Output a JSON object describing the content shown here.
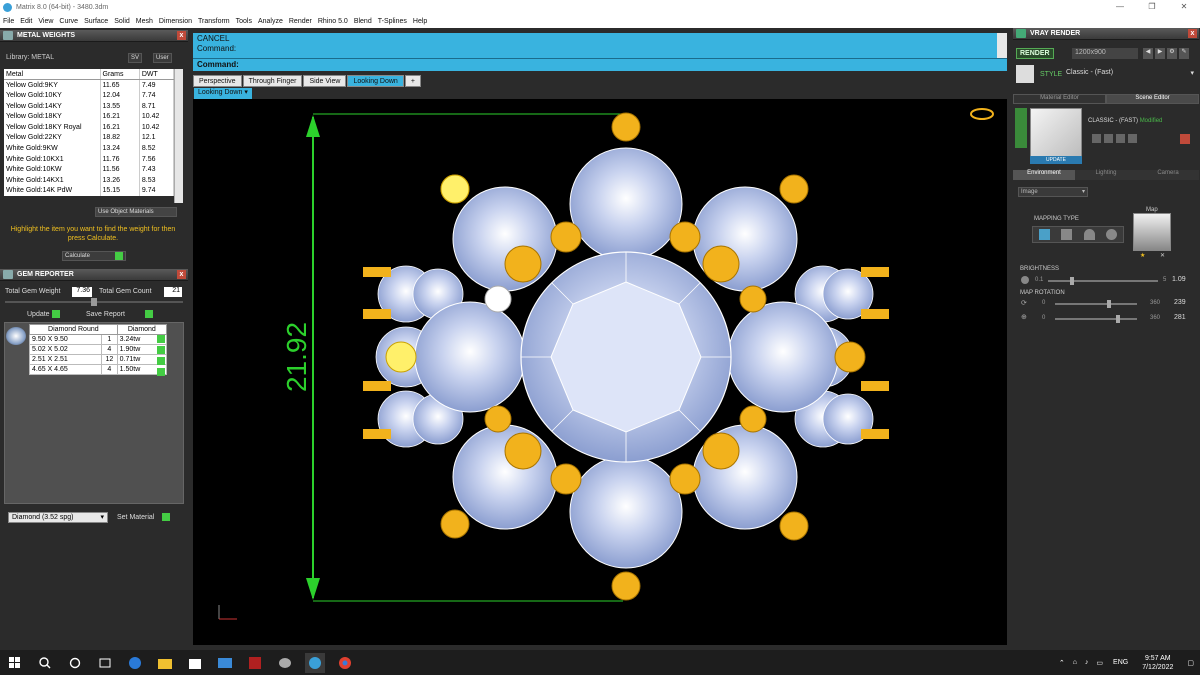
{
  "window": {
    "title": "Matrix 8.0 (64-bit) - 3480.3dm"
  },
  "menu": [
    "File",
    "Edit",
    "View",
    "Curve",
    "Surface",
    "Solid",
    "Mesh",
    "Dimension",
    "Transform",
    "Tools",
    "Analyze",
    "Render",
    "Rhino 5.0",
    "Blend",
    "T-Splines",
    "Help"
  ],
  "metal_weights": {
    "title": "METAL WEIGHTS",
    "library": "Library: METAL",
    "btn_sv": "SV",
    "btn_user": "User",
    "columns": [
      "Metal",
      "Grams",
      "DWT"
    ],
    "rows": [
      [
        "Yellow Gold:9KY",
        "11.65",
        "7.49"
      ],
      [
        "Yellow Gold:10KY",
        "12.04",
        "7.74"
      ],
      [
        "Yellow Gold:14KY",
        "13.55",
        "8.71"
      ],
      [
        "Yellow Gold:18KY",
        "16.21",
        "10.42"
      ],
      [
        "Yellow Gold:18KY Royal",
        "16.21",
        "10.42"
      ],
      [
        "Yellow Gold:22KY",
        "18.82",
        "12.1"
      ],
      [
        "White Gold:9KW",
        "13.24",
        "8.52"
      ],
      [
        "White Gold:10KX1",
        "11.76",
        "7.56"
      ],
      [
        "White Gold:10KW",
        "11.56",
        "7.43"
      ],
      [
        "White Gold:14KX1",
        "13.26",
        "8.53"
      ],
      [
        "White Gold:14K PdW",
        "15.15",
        "9.74"
      ]
    ],
    "use_object_materials": "Use Object Materials",
    "hint": "Highlight the item you want to find the weight for then press Calculate.",
    "calculate": "Calculate"
  },
  "gem_reporter": {
    "title": "GEM REPORTER",
    "total_gem_weight_label": "Total Gem Weight",
    "total_gem_weight": "7.36",
    "total_gem_count_label": "Total Gem Count",
    "total_gem_count": "21",
    "update": "Update",
    "save_report": "Save Report",
    "columns": [
      "Diamond Round",
      "Diamond"
    ],
    "rows": [
      [
        "9.50 X 9.50",
        "1",
        "3.24tw"
      ],
      [
        "5.02 X 5.02",
        "4",
        "1.90tw"
      ],
      [
        "2.51 X 2.51",
        "12",
        "0.71tw"
      ],
      [
        "4.65 X 4.65",
        "4",
        "1.50tw"
      ]
    ],
    "material_select": "Diamond   (3.52 spg)",
    "set_material": "Set Material"
  },
  "command": {
    "cancel": "CANCEL",
    "prompt1": "Command:",
    "prompt2": "Command:"
  },
  "view_tabs": [
    "Perspective",
    "Through Finger",
    "Side View",
    "Looking Down"
  ],
  "active_view": "Looking Down",
  "viewport": {
    "dimension_label": "21.92"
  },
  "vray": {
    "title": "VRAY RENDER",
    "render_btn": "RENDER",
    "resolution": "1200x900",
    "style_label": "STYLE",
    "style_value": "Classic - (Fast)",
    "tab_material": "Material Editor",
    "tab_scene": "Scene Editor",
    "preset_name": "CLASSIC - (FAST)",
    "preset_state": "Modified",
    "update": "UPDATE",
    "sub_tabs": [
      "Environment",
      "Lighting",
      "Camera"
    ],
    "env_select": "Image",
    "mapping_type": "MAPPING TYPE",
    "map_label": "Map",
    "brightness_label": "BRIGHTNESS",
    "brightness_min": "0.1",
    "brightness_max": "5",
    "brightness_value": "1.09",
    "brightness_fraction": 0.21,
    "map_rotation_label": "MAP ROTATION",
    "rot1_min": "0",
    "rot1_max": "360",
    "rot1_value": "239",
    "rot2_min": "0",
    "rot2_max": "360",
    "rot2_value": "281"
  },
  "taskbar": {
    "lang": "ENG",
    "time": "9:57 AM",
    "date": "7/12/2022"
  }
}
